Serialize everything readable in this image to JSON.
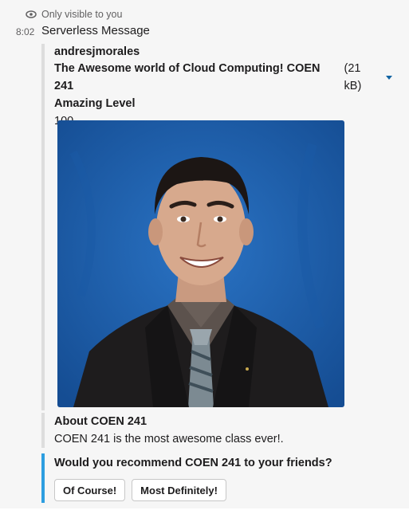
{
  "visibility_note": "Only visible to you",
  "message": {
    "time": "8:02",
    "sender": "Serverless Message"
  },
  "attachment": {
    "author": "andresjmorales",
    "file_title": "The Awesome world of Cloud Computing! COEN 241",
    "file_size": "(21 kB)",
    "field_title": "Amazing Level",
    "field_value": "100"
  },
  "about": {
    "title": "About COEN 241",
    "text": "COEN 241 is the most awesome class ever!."
  },
  "question": {
    "text": "Would you recommend COEN 241 to your friends?",
    "buttons": [
      "Of Course!",
      "Most Definitely!"
    ]
  },
  "colors": {
    "background": "#f6f6f6",
    "accent": "#2d9ee0",
    "link": "#1264a3",
    "photo_background": "#1c5aa8"
  }
}
